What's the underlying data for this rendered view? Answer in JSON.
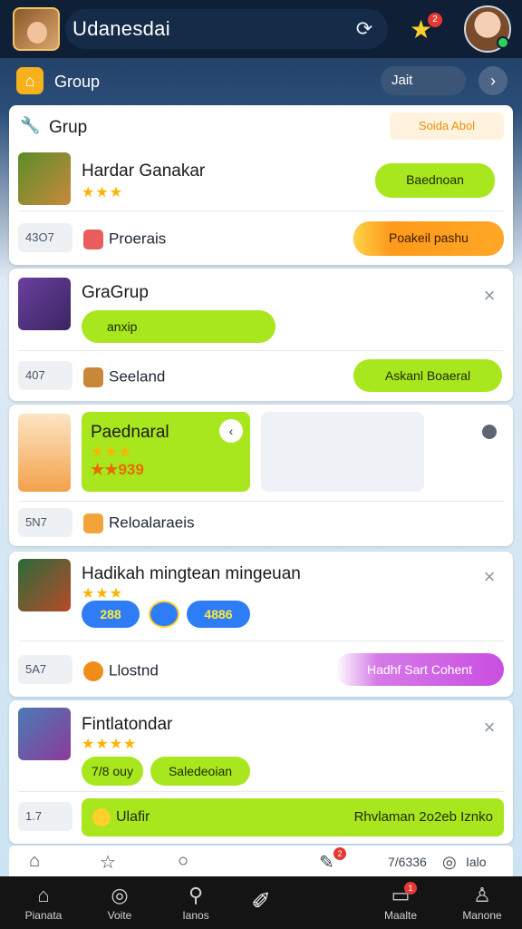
{
  "header": {
    "title": "Udanesdai",
    "notif_count": "2",
    "icons": [
      "refresh-icon",
      "star-icon",
      "avatar"
    ]
  },
  "group_bar": {
    "label": "Group",
    "join_label": "Jait",
    "arrow": "›"
  },
  "card1": {
    "heading": "Grup",
    "tags": "Soida  Abol",
    "name": "Hardar Ganakar",
    "stars": "★★★",
    "status_btn": "Baednoan",
    "meta": "43O7",
    "info": "Proerais",
    "action": "Poakeil pashu"
  },
  "card2": {
    "name": "GraGrup",
    "progress_label": "anxip",
    "meta": "407",
    "info": "Seeland",
    "action": "Askanl Boaeral"
  },
  "card3": {
    "name": "Paednaral",
    "stars": "★★★",
    "score": "★★939",
    "meta": "5N7",
    "info": "Reloalaraeis"
  },
  "card4": {
    "name": "Hadikah mingtean mingeuan",
    "stars": "★★★",
    "chip1": "288",
    "chip2": "4886",
    "meta": "5A7",
    "info": "Llostnd",
    "action": "Hadhf Sart Cohent"
  },
  "card5": {
    "name": "Fintlatondar",
    "stars": "★★★★",
    "btn1": "7/8 ouy",
    "btn2": "Saledeoian",
    "meta": "1.7",
    "bar_left": "Ulafir",
    "bar_right": "Rhvlaman 2o2eb Iznko"
  },
  "subnav": {
    "right_text": "7/6336",
    "right_text2": "Ialo",
    "badge": "2"
  },
  "nav": {
    "items": [
      {
        "label": "Pianata",
        "icon": "home-icon"
      },
      {
        "label": "Voite",
        "icon": "compass-icon"
      },
      {
        "label": "Ianos",
        "icon": "search-icon"
      },
      {
        "label": "",
        "icon": "brush-icon"
      },
      {
        "label": "Maalte",
        "icon": "bag-icon"
      },
      {
        "label": "Manone",
        "icon": "person-icon"
      }
    ],
    "badge": "1"
  }
}
